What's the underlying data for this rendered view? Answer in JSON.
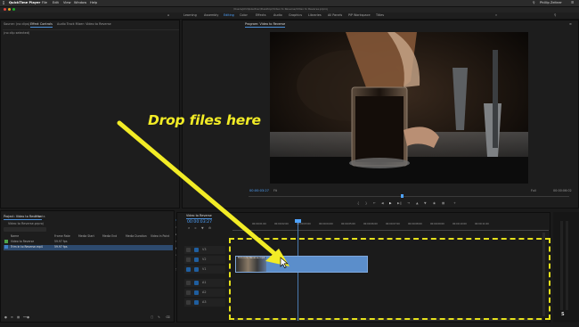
{
  "menubar": {
    "app_name": "QuickTime Player",
    "menus": [
      "File",
      "Edit",
      "View",
      "Window",
      "Help"
    ],
    "user": "Phillip Zeitner"
  },
  "window": {
    "title": "/Users/phillipzeitner/Desktop/Video to Reverse/Video to Reverse.prproj"
  },
  "workspaces": [
    {
      "label": "Learning"
    },
    {
      "label": "Assembly"
    },
    {
      "label": "Editing",
      "active": true
    },
    {
      "label": "Color"
    },
    {
      "label": "Effects"
    },
    {
      "label": "Audio"
    },
    {
      "label": "Graphics"
    },
    {
      "label": "Libraries"
    },
    {
      "label": "All Panels"
    },
    {
      "label": "PiP Workspace"
    },
    {
      "label": "Titles"
    }
  ],
  "source_panel": {
    "tabs": [
      "Source: (no clips)",
      "Effect Controls",
      "Audio Track Mixer: Video to Reverse"
    ],
    "active_tab_index": 1,
    "empty_text": "(no clip selected)"
  },
  "program_monitor": {
    "title": "Program: Video to Reverse",
    "timecode": "00:00:03:27",
    "fit": "Fit",
    "scale": "Full",
    "duration": "00:00:06:02"
  },
  "project_panel": {
    "tabs": [
      "Project: Video to Reverse",
      "Effects"
    ],
    "file_name": "Video to Reverse.prproj",
    "headers": [
      "Name",
      "Frame Rate",
      "Media Start",
      "Media End",
      "Media Duration",
      "Video In Point"
    ],
    "rows": [
      {
        "name": "Video to Reverse",
        "frame_rate": "59.97 fps",
        "color": "#4ea34a"
      },
      {
        "name": "Trim in to Reverse.mp4",
        "frame_rate": "59.97 fps",
        "color": "#3d7fc6"
      }
    ]
  },
  "timeline": {
    "sequence_name": "Video to Reverse",
    "timecode": "00:00:03:27",
    "ruler_labels": [
      "00:00:01:00",
      "00:00:02:00",
      "00:00:03:00",
      "00:00:04:00",
      "00:00:05:00",
      "00:00:06:00",
      "00:00:07:00",
      "00:00:08:00",
      "00:00:09:00",
      "00:00:10:00",
      "00:00:11:00"
    ],
    "tracks": [
      "V3",
      "V2",
      "V1",
      "A1",
      "A2",
      "A3"
    ],
    "clip_label": "Trim in to Reverse.mp4"
  },
  "overlay": {
    "drop_label": "Drop files here",
    "accent_color": "#f2ec26"
  }
}
